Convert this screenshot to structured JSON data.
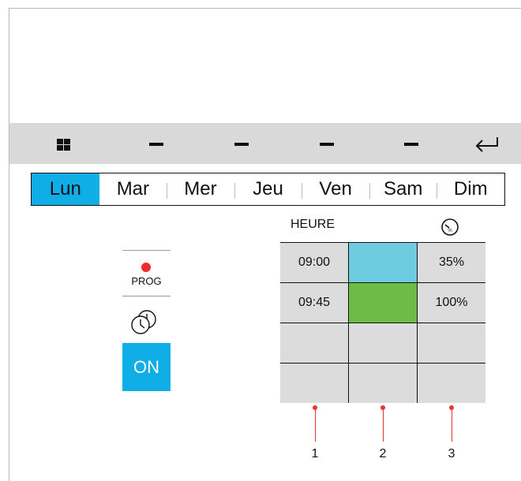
{
  "days": [
    {
      "label": "Lun",
      "active": true
    },
    {
      "label": "Mar",
      "active": false
    },
    {
      "label": "Mer",
      "active": false
    },
    {
      "label": "Jeu",
      "active": false
    },
    {
      "label": "Ven",
      "active": false
    },
    {
      "label": "Sam",
      "active": false
    },
    {
      "label": "Dim",
      "active": false
    }
  ],
  "side": {
    "prog_label": "PROG",
    "on_label": "ON"
  },
  "table": {
    "header_time": "HEURE",
    "rows": [
      {
        "time": "09:00",
        "color": "#6fcbe0",
        "value": "35%"
      },
      {
        "time": "09:45",
        "color": "#6cbc45",
        "value": "100%"
      },
      {
        "time": "",
        "color": "",
        "value": ""
      },
      {
        "time": "",
        "color": "",
        "value": ""
      }
    ]
  },
  "callouts": [
    "1",
    "2",
    "3"
  ],
  "colors": {
    "accent": "#10aee6",
    "prog_dot": "#ef2b2b",
    "callout": "#e53535"
  }
}
